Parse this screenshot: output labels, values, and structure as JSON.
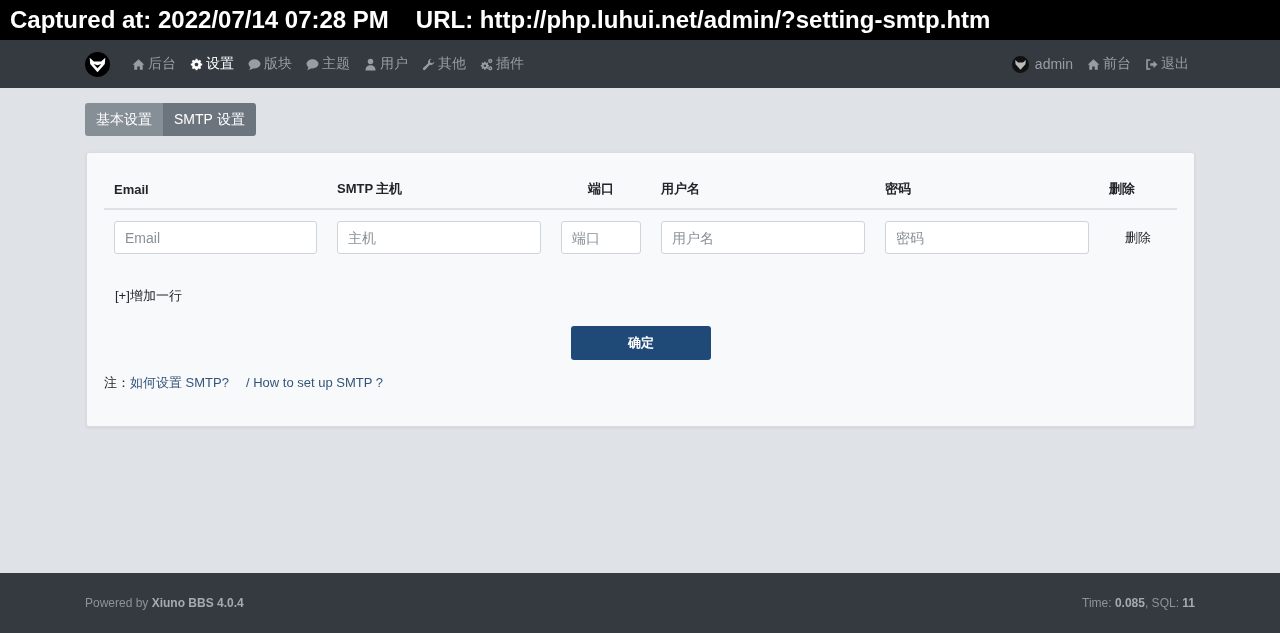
{
  "capture_banner": {
    "timestamp": "Captured at: 2022/07/14 07:28 PM",
    "url": "URL: http://php.luhui.net/admin/?setting-smtp.htm"
  },
  "navbar": {
    "items": [
      {
        "kind": "dashboard",
        "label": "后台",
        "selected": false
      },
      {
        "kind": "settings",
        "label": "设置",
        "selected": true
      },
      {
        "kind": "forums",
        "label": "版块",
        "selected": false
      },
      {
        "kind": "threads",
        "label": "主题",
        "selected": false
      },
      {
        "kind": "users",
        "label": "用户",
        "selected": false
      },
      {
        "kind": "other",
        "label": "其他",
        "selected": false
      },
      {
        "kind": "plugins",
        "label": "插件",
        "selected": false
      }
    ],
    "user": {
      "name": "admin"
    },
    "links": [
      {
        "kind": "home",
        "label": "前台"
      },
      {
        "kind": "logout",
        "label": "退出"
      }
    ]
  },
  "tabs": [
    {
      "label": "基本设置",
      "selected": false
    },
    {
      "label": "SMTP 设置",
      "selected": true
    }
  ],
  "smtp_table": {
    "columns": [
      "Email",
      "SMTP 主机",
      "端口",
      "用户名",
      "密码",
      "删除"
    ],
    "rows": [
      {
        "fields": [
          {
            "placeholder": "Email"
          },
          {
            "placeholder": "主机"
          },
          {
            "placeholder": "端口"
          },
          {
            "placeholder": "用户名"
          },
          {
            "placeholder": "密码"
          }
        ],
        "delete_label": "删除"
      }
    ]
  },
  "add_row_link": "[+]增加一行",
  "submit_button": "确定",
  "note": {
    "label": "注：",
    "links": [
      "如何设置 SMTP?",
      "/ How to set up SMTP ?"
    ]
  },
  "footer": {
    "powered_by": "Powered by **Xiuno BBS 4.0.4**",
    "stats": "Time: **0.085**, SQL: **11**"
  }
}
